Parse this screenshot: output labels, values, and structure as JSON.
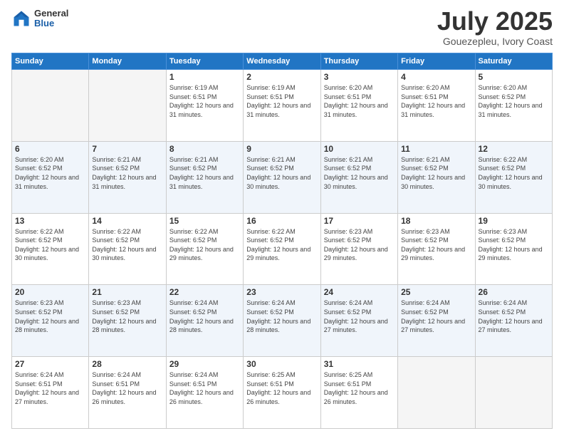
{
  "header": {
    "logo_general": "General",
    "logo_blue": "Blue",
    "title": "July 2025",
    "location": "Gouezepleu, Ivory Coast"
  },
  "days_of_week": [
    "Sunday",
    "Monday",
    "Tuesday",
    "Wednesday",
    "Thursday",
    "Friday",
    "Saturday"
  ],
  "weeks": [
    {
      "days": [
        {
          "num": "",
          "detail": "",
          "empty": true
        },
        {
          "num": "",
          "detail": "",
          "empty": true
        },
        {
          "num": "1",
          "detail": "Sunrise: 6:19 AM\nSunset: 6:51 PM\nDaylight: 12 hours and 31 minutes."
        },
        {
          "num": "2",
          "detail": "Sunrise: 6:19 AM\nSunset: 6:51 PM\nDaylight: 12 hours and 31 minutes."
        },
        {
          "num": "3",
          "detail": "Sunrise: 6:20 AM\nSunset: 6:51 PM\nDaylight: 12 hours and 31 minutes."
        },
        {
          "num": "4",
          "detail": "Sunrise: 6:20 AM\nSunset: 6:51 PM\nDaylight: 12 hours and 31 minutes."
        },
        {
          "num": "5",
          "detail": "Sunrise: 6:20 AM\nSunset: 6:52 PM\nDaylight: 12 hours and 31 minutes."
        }
      ]
    },
    {
      "days": [
        {
          "num": "6",
          "detail": "Sunrise: 6:20 AM\nSunset: 6:52 PM\nDaylight: 12 hours and 31 minutes."
        },
        {
          "num": "7",
          "detail": "Sunrise: 6:21 AM\nSunset: 6:52 PM\nDaylight: 12 hours and 31 minutes."
        },
        {
          "num": "8",
          "detail": "Sunrise: 6:21 AM\nSunset: 6:52 PM\nDaylight: 12 hours and 31 minutes."
        },
        {
          "num": "9",
          "detail": "Sunrise: 6:21 AM\nSunset: 6:52 PM\nDaylight: 12 hours and 30 minutes."
        },
        {
          "num": "10",
          "detail": "Sunrise: 6:21 AM\nSunset: 6:52 PM\nDaylight: 12 hours and 30 minutes."
        },
        {
          "num": "11",
          "detail": "Sunrise: 6:21 AM\nSunset: 6:52 PM\nDaylight: 12 hours and 30 minutes."
        },
        {
          "num": "12",
          "detail": "Sunrise: 6:22 AM\nSunset: 6:52 PM\nDaylight: 12 hours and 30 minutes."
        }
      ]
    },
    {
      "days": [
        {
          "num": "13",
          "detail": "Sunrise: 6:22 AM\nSunset: 6:52 PM\nDaylight: 12 hours and 30 minutes."
        },
        {
          "num": "14",
          "detail": "Sunrise: 6:22 AM\nSunset: 6:52 PM\nDaylight: 12 hours and 30 minutes."
        },
        {
          "num": "15",
          "detail": "Sunrise: 6:22 AM\nSunset: 6:52 PM\nDaylight: 12 hours and 29 minutes."
        },
        {
          "num": "16",
          "detail": "Sunrise: 6:22 AM\nSunset: 6:52 PM\nDaylight: 12 hours and 29 minutes."
        },
        {
          "num": "17",
          "detail": "Sunrise: 6:23 AM\nSunset: 6:52 PM\nDaylight: 12 hours and 29 minutes."
        },
        {
          "num": "18",
          "detail": "Sunrise: 6:23 AM\nSunset: 6:52 PM\nDaylight: 12 hours and 29 minutes."
        },
        {
          "num": "19",
          "detail": "Sunrise: 6:23 AM\nSunset: 6:52 PM\nDaylight: 12 hours and 29 minutes."
        }
      ]
    },
    {
      "days": [
        {
          "num": "20",
          "detail": "Sunrise: 6:23 AM\nSunset: 6:52 PM\nDaylight: 12 hours and 28 minutes."
        },
        {
          "num": "21",
          "detail": "Sunrise: 6:23 AM\nSunset: 6:52 PM\nDaylight: 12 hours and 28 minutes."
        },
        {
          "num": "22",
          "detail": "Sunrise: 6:24 AM\nSunset: 6:52 PM\nDaylight: 12 hours and 28 minutes."
        },
        {
          "num": "23",
          "detail": "Sunrise: 6:24 AM\nSunset: 6:52 PM\nDaylight: 12 hours and 28 minutes."
        },
        {
          "num": "24",
          "detail": "Sunrise: 6:24 AM\nSunset: 6:52 PM\nDaylight: 12 hours and 27 minutes."
        },
        {
          "num": "25",
          "detail": "Sunrise: 6:24 AM\nSunset: 6:52 PM\nDaylight: 12 hours and 27 minutes."
        },
        {
          "num": "26",
          "detail": "Sunrise: 6:24 AM\nSunset: 6:52 PM\nDaylight: 12 hours and 27 minutes."
        }
      ]
    },
    {
      "days": [
        {
          "num": "27",
          "detail": "Sunrise: 6:24 AM\nSunset: 6:51 PM\nDaylight: 12 hours and 27 minutes."
        },
        {
          "num": "28",
          "detail": "Sunrise: 6:24 AM\nSunset: 6:51 PM\nDaylight: 12 hours and 26 minutes."
        },
        {
          "num": "29",
          "detail": "Sunrise: 6:24 AM\nSunset: 6:51 PM\nDaylight: 12 hours and 26 minutes."
        },
        {
          "num": "30",
          "detail": "Sunrise: 6:25 AM\nSunset: 6:51 PM\nDaylight: 12 hours and 26 minutes."
        },
        {
          "num": "31",
          "detail": "Sunrise: 6:25 AM\nSunset: 6:51 PM\nDaylight: 12 hours and 26 minutes."
        },
        {
          "num": "",
          "detail": "",
          "empty": true
        },
        {
          "num": "",
          "detail": "",
          "empty": true
        }
      ]
    }
  ]
}
